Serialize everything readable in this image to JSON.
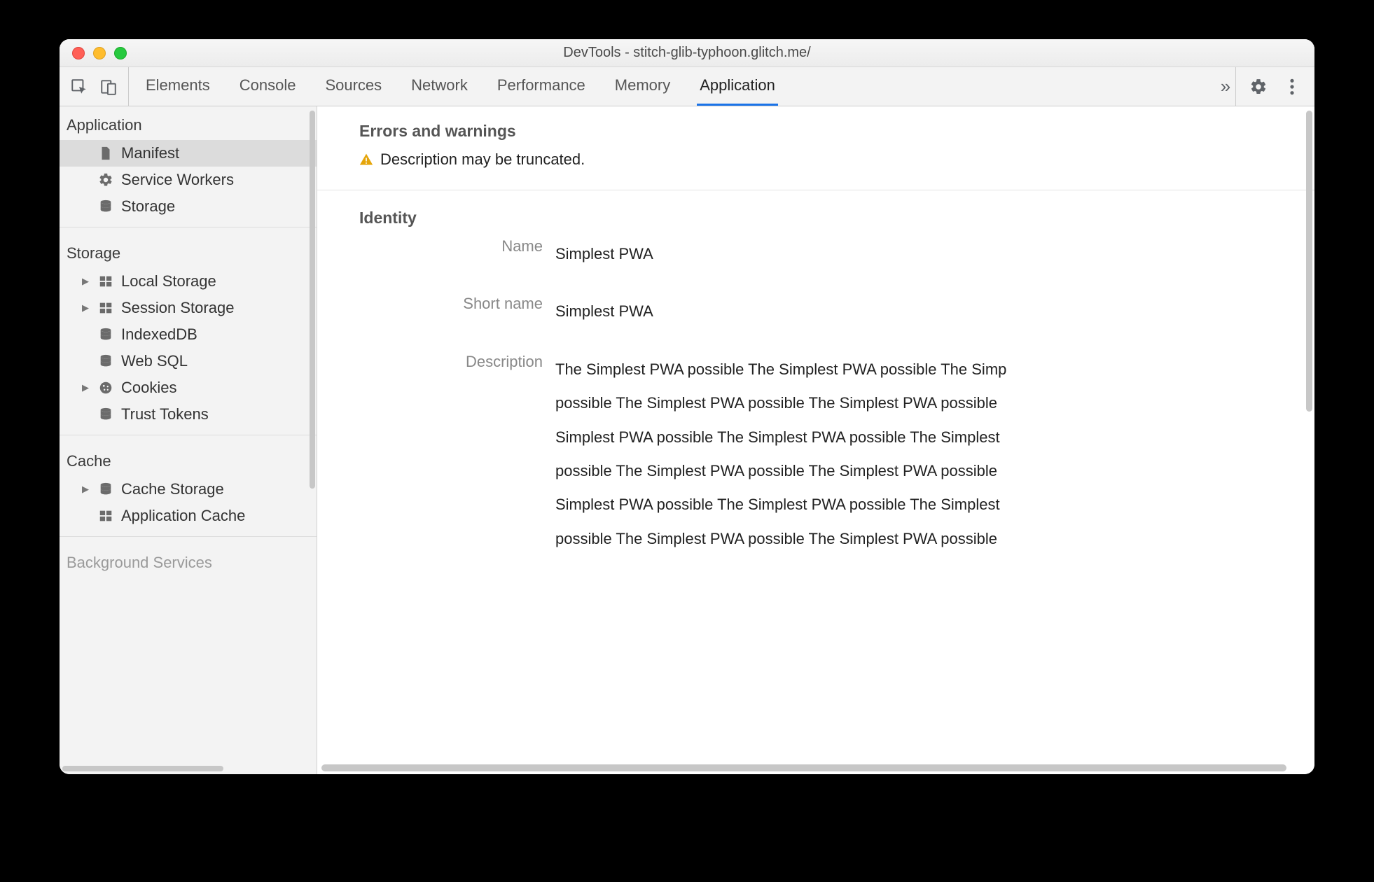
{
  "window": {
    "title": "DevTools - stitch-glib-typhoon.glitch.me/"
  },
  "toolbar": {
    "tabs": [
      {
        "label": "Elements",
        "active": false
      },
      {
        "label": "Console",
        "active": false
      },
      {
        "label": "Sources",
        "active": false
      },
      {
        "label": "Network",
        "active": false
      },
      {
        "label": "Performance",
        "active": false
      },
      {
        "label": "Memory",
        "active": false
      },
      {
        "label": "Application",
        "active": true
      }
    ],
    "more_tabs_glyph": "»"
  },
  "sidebar": {
    "sections": [
      {
        "title": "Application",
        "items": [
          {
            "icon": "file",
            "label": "Manifest",
            "selected": true
          },
          {
            "icon": "gear",
            "label": "Service Workers"
          },
          {
            "icon": "db",
            "label": "Storage"
          }
        ]
      },
      {
        "title": "Storage",
        "items": [
          {
            "icon": "grid",
            "label": "Local Storage",
            "expandable": true
          },
          {
            "icon": "grid",
            "label": "Session Storage",
            "expandable": true
          },
          {
            "icon": "db",
            "label": "IndexedDB"
          },
          {
            "icon": "db",
            "label": "Web SQL"
          },
          {
            "icon": "cookie",
            "label": "Cookies",
            "expandable": true
          },
          {
            "icon": "db",
            "label": "Trust Tokens"
          }
        ]
      },
      {
        "title": "Cache",
        "items": [
          {
            "icon": "db",
            "label": "Cache Storage",
            "expandable": true
          },
          {
            "icon": "grid",
            "label": "Application Cache"
          }
        ]
      },
      {
        "title": "Background Services",
        "items": []
      }
    ]
  },
  "content": {
    "errors_heading": "Errors and warnings",
    "warning_text": "Description may be truncated.",
    "identity_heading": "Identity",
    "identity": {
      "name_label": "Name",
      "name_value": "Simplest PWA",
      "short_name_label": "Short name",
      "short_name_value": "Simplest PWA",
      "description_label": "Description",
      "description_value": "The Simplest PWA possible The Simplest PWA possible The Simp\npossible The Simplest PWA possible The Simplest PWA possible \nSimplest PWA possible The Simplest PWA possible The Simplest\npossible The Simplest PWA possible The Simplest PWA possible \nSimplest PWA possible The Simplest PWA possible The Simplest\npossible The Simplest PWA possible The Simplest PWA possible"
    }
  },
  "colors": {
    "accent": "#1a73e8",
    "warning": "#e5a50a"
  }
}
